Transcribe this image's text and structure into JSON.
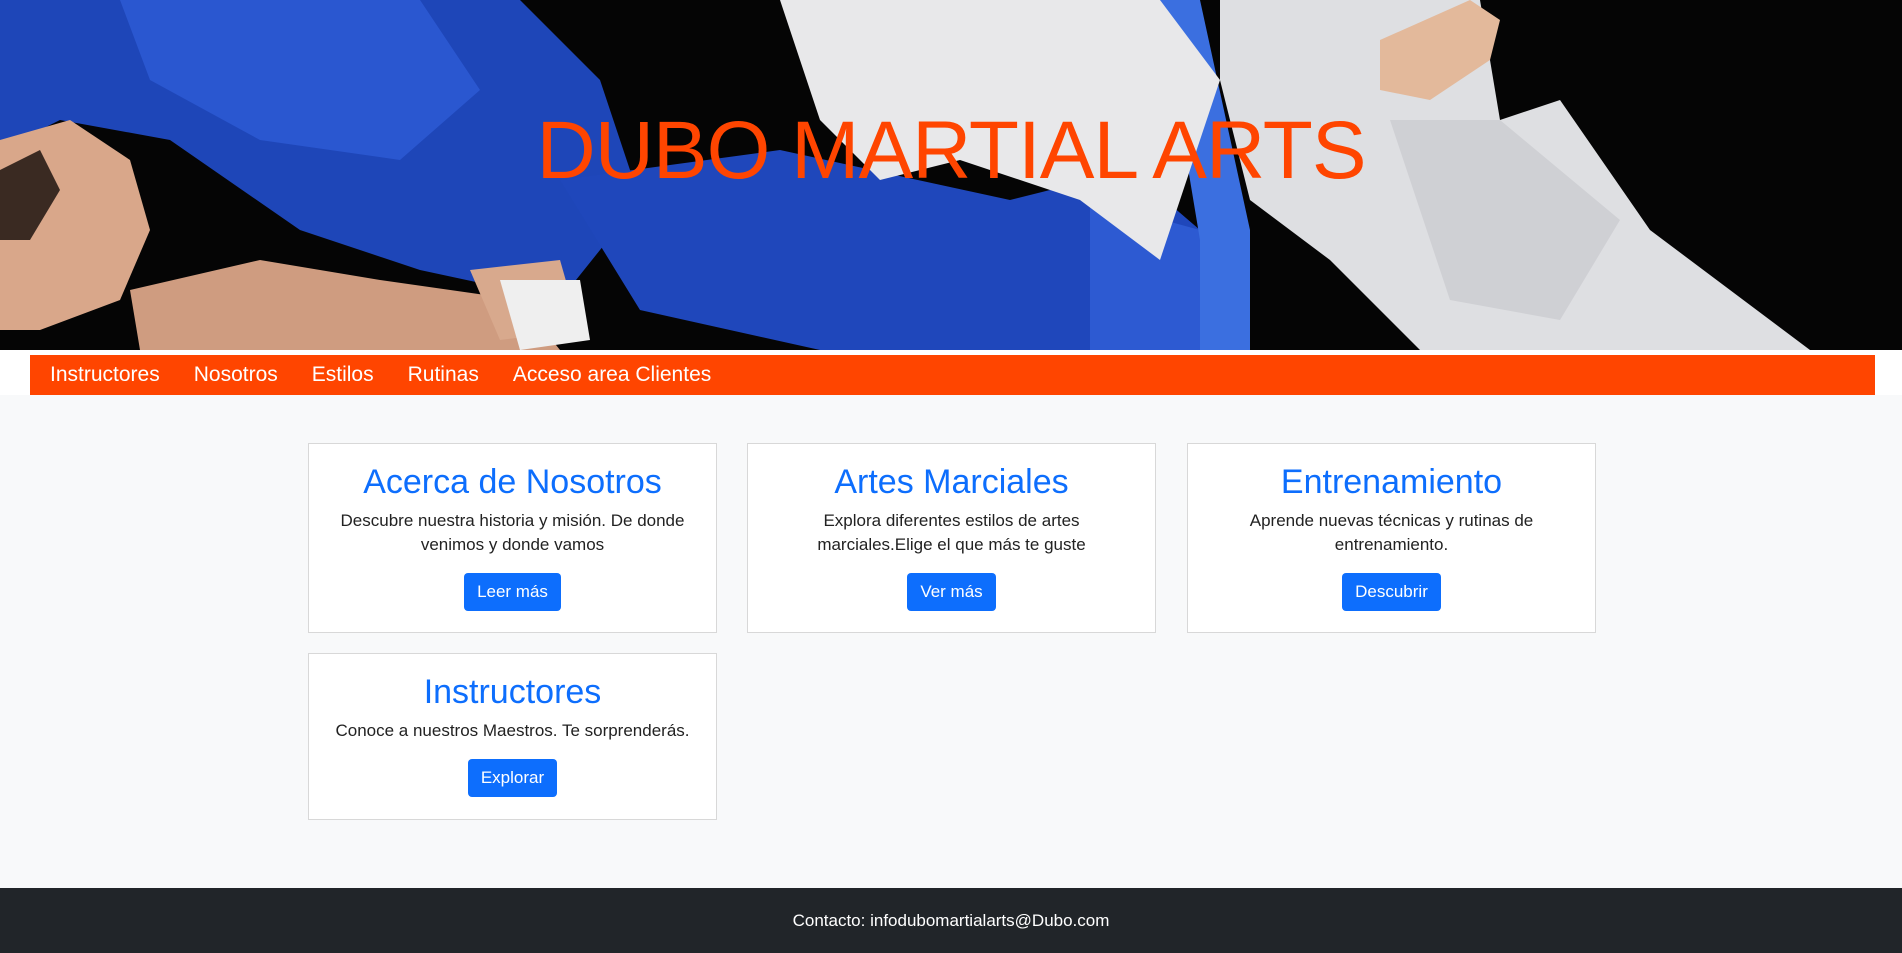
{
  "hero": {
    "title": "DUBO MARTIAL ARTS",
    "accent_color": "#ff4500"
  },
  "nav": {
    "items": [
      {
        "label": "Instructores"
      },
      {
        "label": "Nosotros"
      },
      {
        "label": "Estilos"
      },
      {
        "label": "Rutinas"
      },
      {
        "label": "Acceso area Clientes"
      }
    ],
    "background": "#ff4500"
  },
  "cards": [
    {
      "title": "Acerca de Nosotros",
      "text": "Descubre nuestra historia y misión. De donde venimos y donde vamos",
      "button": "Leer más"
    },
    {
      "title": "Artes Marciales",
      "text": "Explora diferentes estilos de artes marciales.Elige el que más te guste",
      "button": "Ver más"
    },
    {
      "title": "Entrenamiento",
      "text": "Aprende nuevas técnicas y rutinas de entrenamiento.",
      "button": "Descubrir"
    },
    {
      "title": "Instructores",
      "text": "Conoce a nuestros Maestros. Te sorprenderás.",
      "button": "Explorar"
    }
  ],
  "footer": {
    "contact": "Contacto: infodubomartialarts@Dubo.com"
  },
  "colors": {
    "link_blue": "#0d6efd",
    "footer_bg": "#212529",
    "page_bg": "#f8f9fa"
  }
}
